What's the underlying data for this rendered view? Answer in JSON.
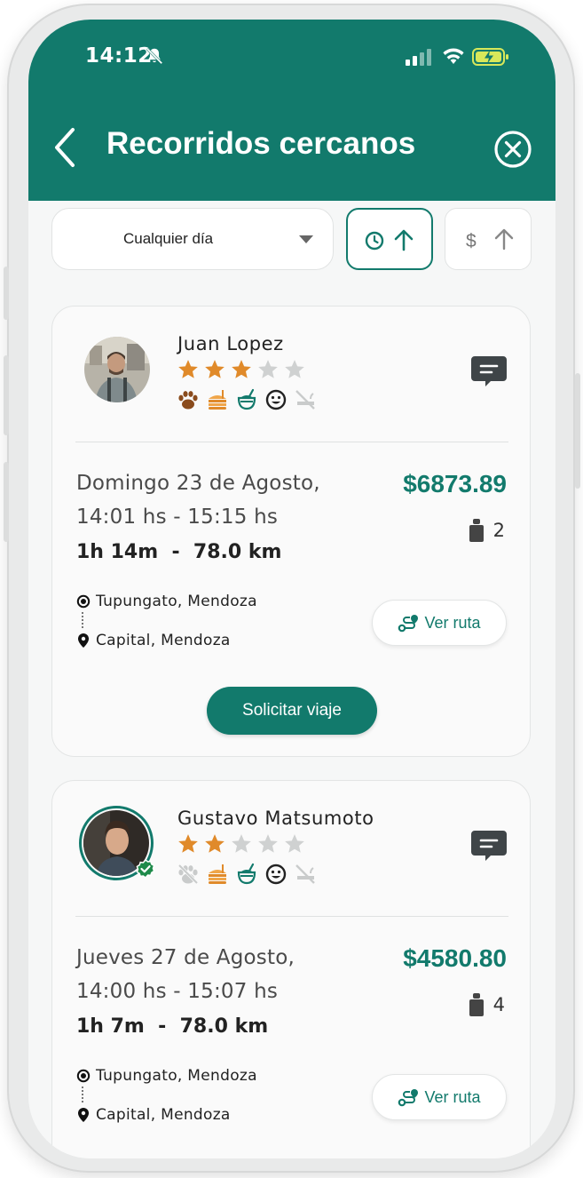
{
  "status_bar": {
    "time": "14:12"
  },
  "header": {
    "title": "Recorridos cercanos"
  },
  "filters": {
    "day_select_value": "Cualquier día",
    "sort_time_active": true,
    "sort_price_active": false,
    "sort_price_symbol": "$"
  },
  "colors": {
    "brand": "#127a6c",
    "star_on": "#e08a2a",
    "star_off": "#cfd1d1"
  },
  "trips": [
    {
      "driver_name": "Juan Lopez",
      "rating": 3,
      "rating_max": 5,
      "verified": false,
      "preferences": [
        "paw-icon",
        "food-icon",
        "mate-icon",
        "smile-icon",
        "no-smoking-icon"
      ],
      "date": "Domingo 23 de Agosto,",
      "time_range": "14:01 hs - 15:15 hs",
      "duration_distance": "1h 14m  -  78.0 km",
      "price": "$6873.89",
      "seats": "2",
      "origin": "Tupungato, Mendoza",
      "destination": "Capital, Mendoza",
      "route_button": "Ver ruta",
      "request_button": "Solicitar viaje"
    },
    {
      "driver_name": "Gustavo Matsumoto",
      "rating": 2,
      "rating_max": 5,
      "verified": true,
      "preferences": [
        "no-pets-icon",
        "food-icon",
        "mate-icon",
        "smile-icon",
        "no-smoking-icon"
      ],
      "date": "Jueves 27 de Agosto,",
      "time_range": "14:00 hs - 15:07 hs",
      "duration_distance": "1h 7m  -  78.0 km",
      "price": "$4580.80",
      "seats": "4",
      "origin": "Tupungato, Mendoza",
      "destination": "Capital, Mendoza",
      "route_button": "Ver ruta"
    }
  ]
}
